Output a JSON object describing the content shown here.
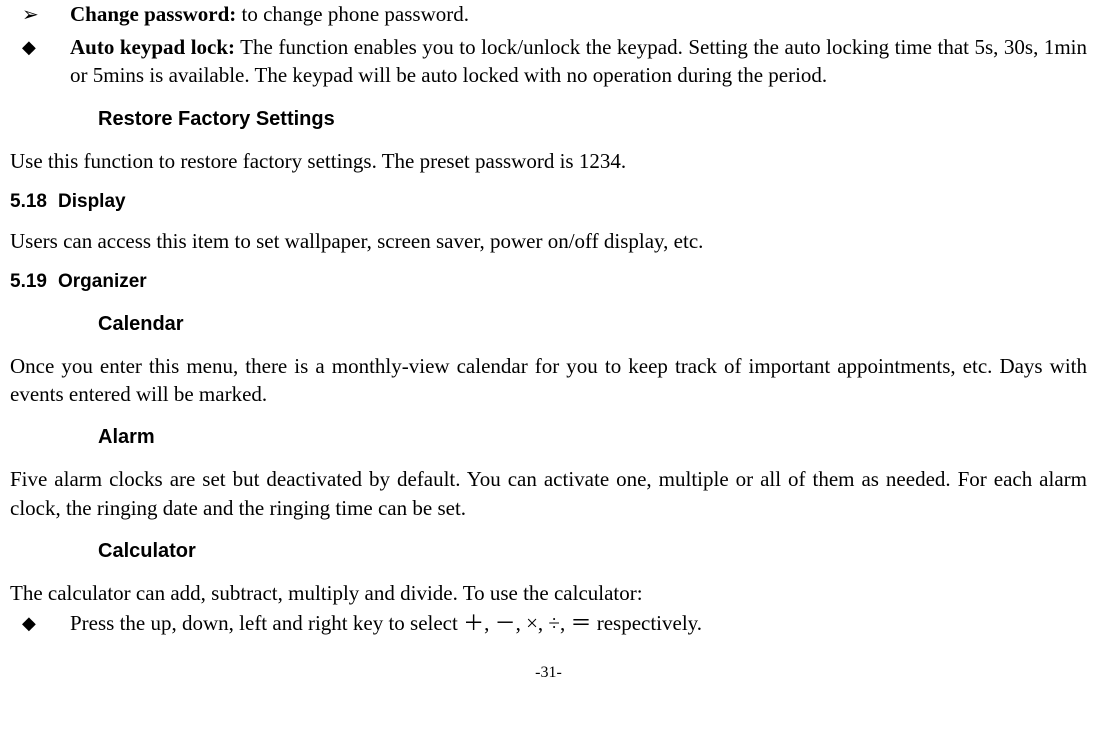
{
  "item1": {
    "title": "Change password:",
    "text": " to change phone password."
  },
  "item2": {
    "title": "Auto keypad lock:",
    "text": " The function enables you to lock/unlock the keypad. Setting the auto locking time that 5s, 30s, 1min or 5mins is available. The keypad will be auto locked with no operation during the period."
  },
  "restore": {
    "heading": "Restore Factory Settings",
    "text": "Use this function to restore factory settings. The preset password is 1234."
  },
  "display": {
    "num": "5.18",
    "title": "Display",
    "text": "Users can access this item to set wallpaper, screen saver, power on/off display, etc."
  },
  "organizer": {
    "num": "5.19",
    "title": "Organizer"
  },
  "calendar": {
    "heading": "Calendar",
    "text": "Once you enter this menu, there is a monthly-view calendar for you to keep track of important appointments, etc. Days with events entered will be marked."
  },
  "alarm": {
    "heading": "Alarm",
    "text": "Five alarm clocks are set but deactivated by default. You can activate one, multiple or all of them as needed. For each alarm clock, the ringing date and the ringing time can be set."
  },
  "calculator": {
    "heading": "Calculator",
    "intro": "The calculator can add, subtract, multiply and divide. To use the calculator:",
    "bullet": "Press the up, down, left and right key to select ＋, －, ×, ÷, ＝ respectively."
  },
  "pagenum": "-31-"
}
